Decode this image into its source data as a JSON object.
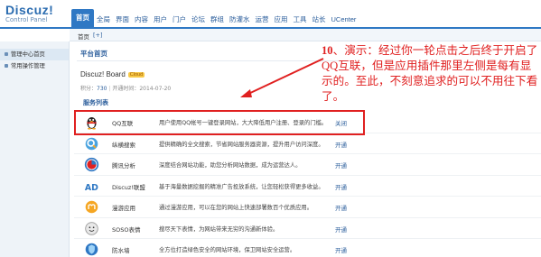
{
  "logo": {
    "main": "Discuz!",
    "sub": "Control Panel"
  },
  "nav": [
    "首页",
    "全局",
    "界面",
    "内容",
    "用户",
    "门户",
    "论坛",
    "群组",
    "防灌水",
    "运营",
    "应用",
    "工具",
    "站长",
    "UCenter"
  ],
  "subbar": {
    "crumb": "首页",
    "plus": "[+]"
  },
  "sidebar": [
    {
      "label": "管理中心首页"
    },
    {
      "label": "常用操作管理"
    }
  ],
  "main": {
    "section_title": "平台首页",
    "board_name": "Discuz! Board",
    "board_badge": "Cloud",
    "meta_prefix": "积分：",
    "meta_points": "730",
    "meta_date": "开通时间：2014-07-20",
    "services_title": "服务列表"
  },
  "services": [
    {
      "icon": "qq-penguin-icon",
      "name": "QQ互联",
      "desc": "用户使用QQ帐号一键登录网站，大大降低用户注册、登录的门槛。",
      "action": "关闭"
    },
    {
      "icon": "cloud-search-icon",
      "name": "纵横搜索",
      "desc": "提供精确的全文搜索，节省网站服务器资源，提升用户访问深度。",
      "action": "开通"
    },
    {
      "icon": "analytics-icon",
      "name": "腾讯分析",
      "desc": "深度结合网站功能，助您分析网站数据，成为运营达人。",
      "action": "开通"
    },
    {
      "icon": "ad-icon",
      "name": "Discuz!联盟",
      "desc": "基于海量数据挖掘的精准广告投放系统，让您轻松获得更多收益。",
      "action": "开通"
    },
    {
      "icon": "orange-app-icon",
      "name": "漫游应用",
      "desc": "通过漫游应用，可以在您的网站上快速部署数百个优质应用。",
      "action": "开通"
    },
    {
      "icon": "soso-face-icon",
      "name": "SOSO表情",
      "desc": "搜尽天下表情，为网站带来无穷的沟通新体验。",
      "action": "开通"
    },
    {
      "icon": "shield-icon",
      "name": "防水墙",
      "desc": "全方位打造绿色安全的网站环境，保卫网站安全运营。",
      "action": "开通"
    }
  ],
  "annotation": {
    "number": "10",
    "text": "、演示：经过你一轮点击之后终于开启了QQ互联，但是应用插件那里左侧是每有显示的。至此，不刻意追求的可以不用往下看了。"
  },
  "colors": {
    "accent": "#2f78c4",
    "annotation": "#e02020"
  }
}
